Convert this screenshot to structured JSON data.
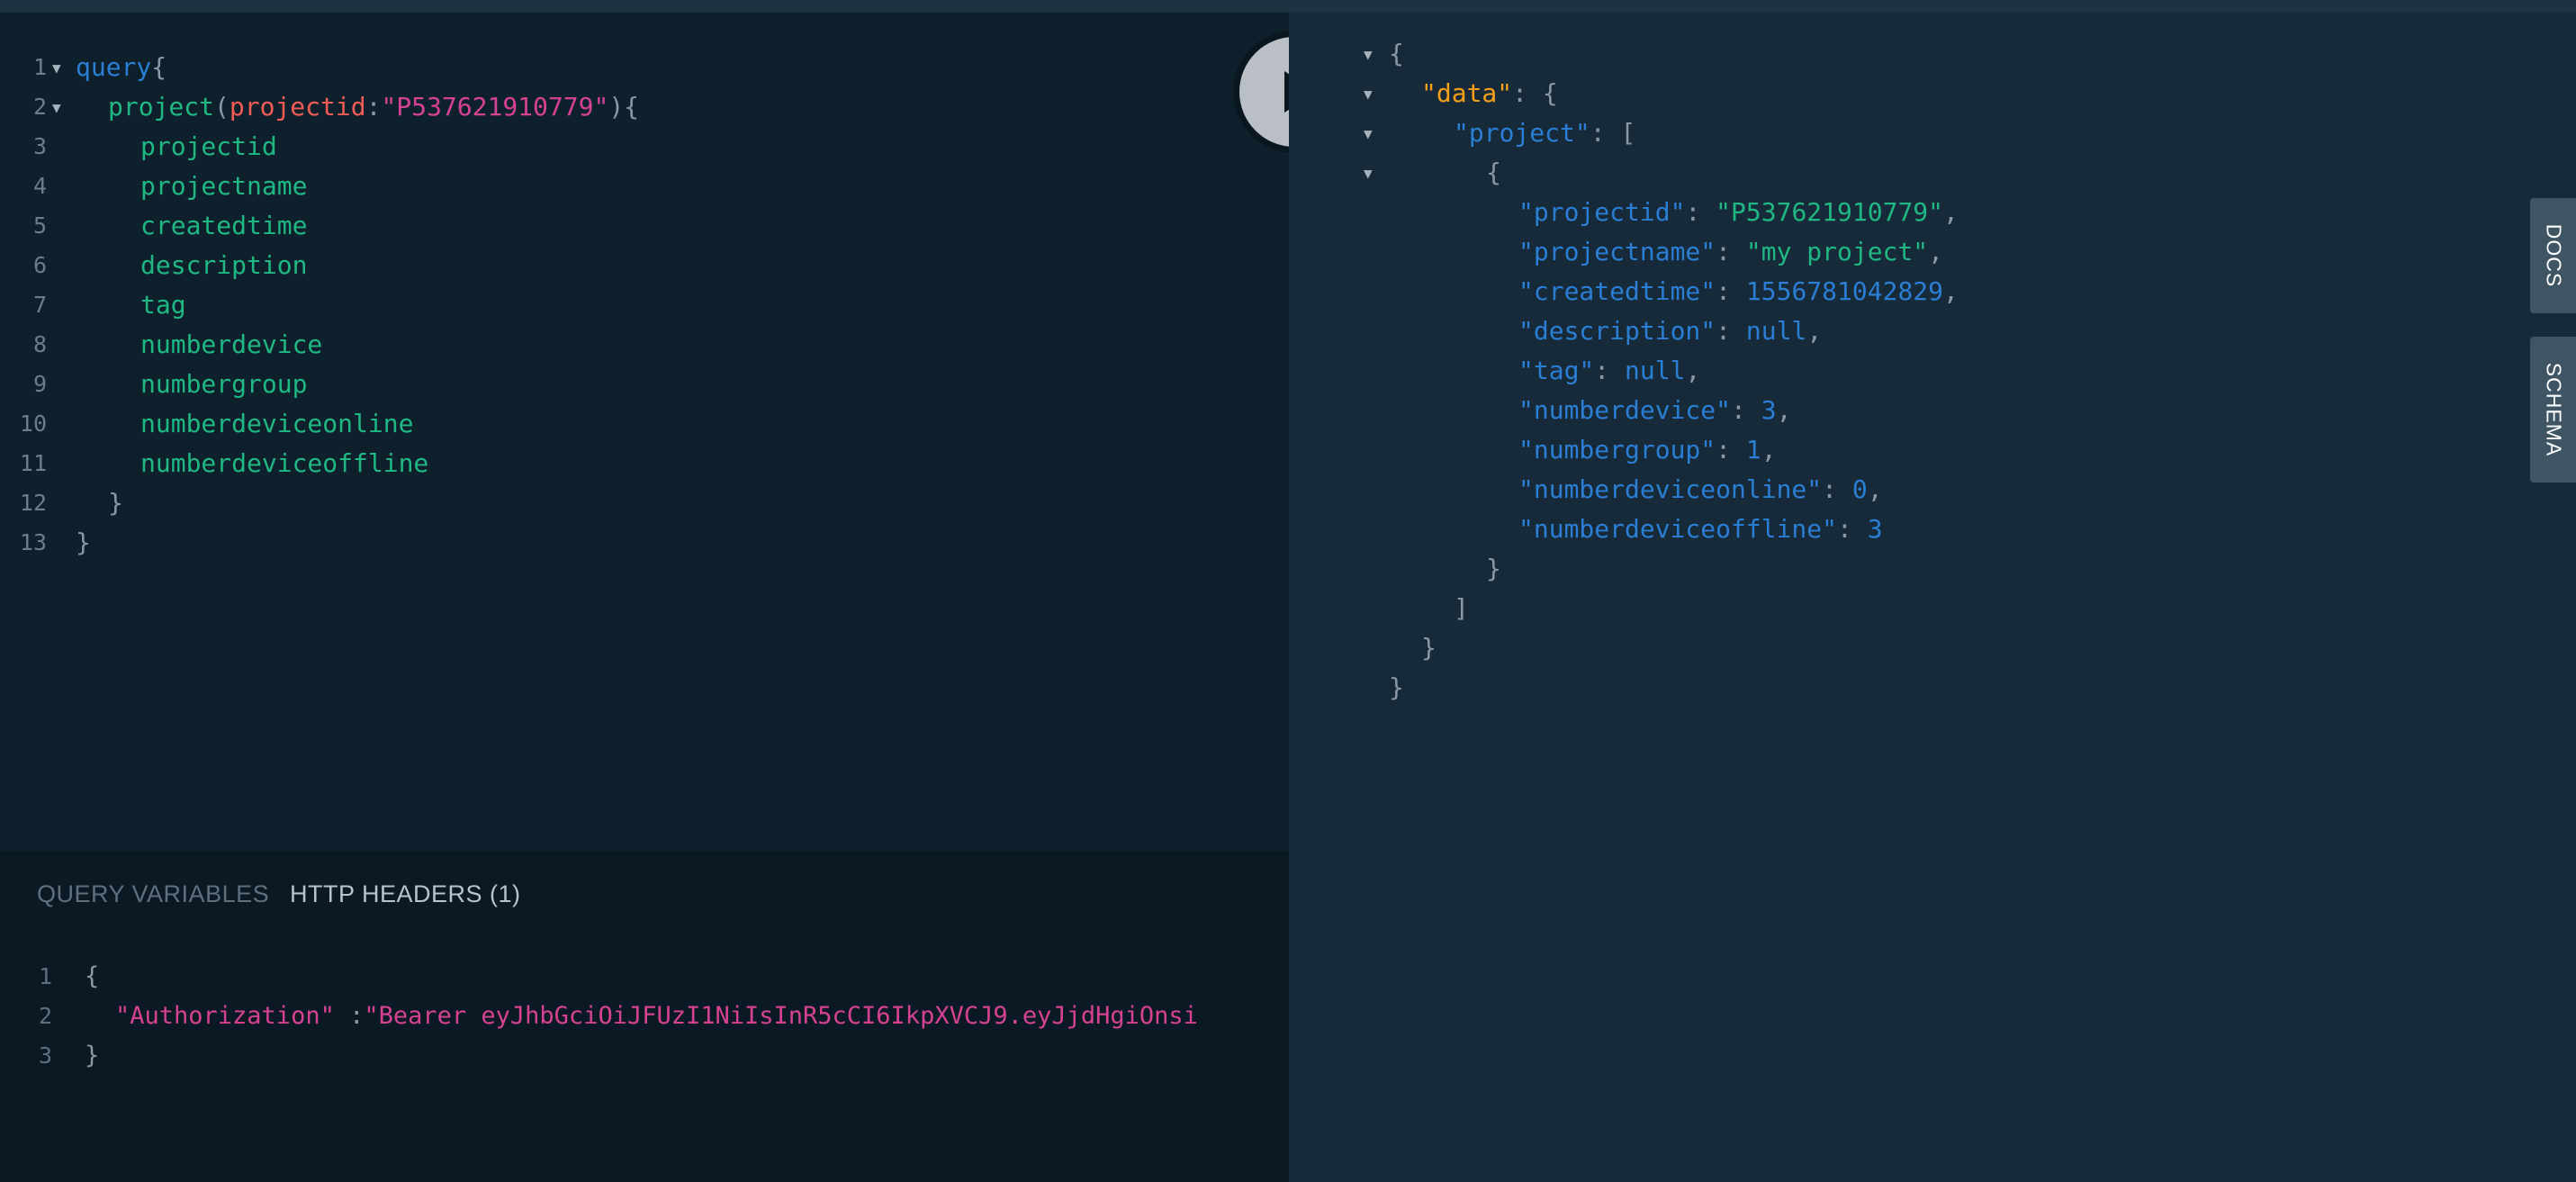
{
  "query_editor": {
    "line_numbers": [
      "1",
      "2",
      "3",
      "4",
      "5",
      "6",
      "7",
      "8",
      "9",
      "10",
      "11",
      "12",
      "13"
    ],
    "keyword": "query",
    "open_brace": "{",
    "field_project": "project",
    "paren_open": "(",
    "arg_name": "projectid",
    "colon": ":",
    "arg_value": "\"P537621910779\"",
    "paren_close_brace": "){",
    "fields": [
      "projectid",
      "projectname",
      "createdtime",
      "description",
      "tag",
      "numberdevice",
      "numbergroup",
      "numberdeviceonline",
      "numberdeviceoffline"
    ],
    "close_inner": "}",
    "close_outer": "}"
  },
  "run_button": {
    "icon": "play-icon"
  },
  "bottom_panel": {
    "tab_query_variables": "QUERY VARIABLES",
    "tab_http_headers": "HTTP HEADERS (1)",
    "line_numbers": [
      "1",
      "2",
      "3"
    ],
    "open_brace": "{",
    "header_key": "\"Authorization\"",
    "header_sep": " :",
    "header_value": "\"Bearer eyJhbGciOiJFUzI1NiIsInR5cCI6IkpXVCJ9.eyJjdHgiOnsi",
    "close_brace": "}"
  },
  "result": {
    "brace_open": "{",
    "data_key": "\"data\"",
    "colon": ": ",
    "brace": "{",
    "project_key": "\"project\"",
    "bracket_open": "[",
    "item_open": "{",
    "rows": [
      {
        "key": "\"projectid\"",
        "value": "\"P537621910779\"",
        "type": "string",
        "comma": ","
      },
      {
        "key": "\"projectname\"",
        "value": "\"my project\"",
        "type": "string",
        "comma": ","
      },
      {
        "key": "\"createdtime\"",
        "value": "1556781042829",
        "type": "number",
        "comma": ","
      },
      {
        "key": "\"description\"",
        "value": "null",
        "type": "null",
        "comma": ","
      },
      {
        "key": "\"tag\"",
        "value": "null",
        "type": "null",
        "comma": ","
      },
      {
        "key": "\"numberdevice\"",
        "value": "3",
        "type": "number",
        "comma": ","
      },
      {
        "key": "\"numbergroup\"",
        "value": "1",
        "type": "number",
        "comma": ","
      },
      {
        "key": "\"numberdeviceonline\"",
        "value": "0",
        "type": "number",
        "comma": ","
      },
      {
        "key": "\"numberdeviceoffline\"",
        "value": "3",
        "type": "number",
        "comma": ""
      }
    ],
    "item_close": "}",
    "bracket_close": "]",
    "data_close": "}",
    "brace_close": "}"
  },
  "side_tabs": {
    "docs": "DOCS",
    "schema": "SCHEMA"
  },
  "colors": {
    "editor_bg": "#0f202d",
    "result_bg": "#172a3a",
    "keyword": "#2a7ed3",
    "field": "#1fb883",
    "argument": "#f25c54",
    "string": "#d64292",
    "data_key": "#f6a01a"
  }
}
